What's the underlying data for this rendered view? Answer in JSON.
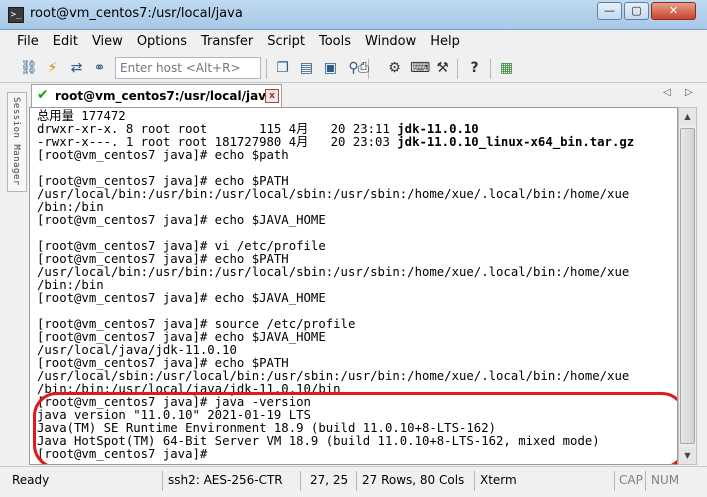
{
  "window": {
    "title": "root@vm_centos7:/usr/local/java",
    "icon_name": "terminal-icon",
    "controls": {
      "minimize": "—",
      "maximize": "▢",
      "close": "✕"
    }
  },
  "menu": [
    "File",
    "Edit",
    "View",
    "Options",
    "Transfer",
    "Script",
    "Tools",
    "Window",
    "Help"
  ],
  "toolbar": {
    "host_placeholder": "Enter host <Alt+R>",
    "icons": [
      "connect-icon",
      "quick-connect-icon",
      "reconnect-icon",
      "disconnect-icon",
      "copy-icon",
      "paste-icon",
      "clipboard-icon",
      "find-icon",
      "print-icon",
      "settings-icon",
      "keyboard-icon",
      "keymap-icon",
      "help-icon",
      "sftp-icon"
    ]
  },
  "tab": {
    "label": "root@vm_centos7:/usr/local/java",
    "status_icon": "✔",
    "close_icon": "x"
  },
  "session_manager_label": "Session Manager",
  "terminal": {
    "lines": [
      {
        "segments": [
          {
            "text": "总用量 177472"
          }
        ]
      },
      {
        "segments": [
          {
            "text": "drwxr-xr-x. 8 root root       115 4月   20 23:11 "
          },
          {
            "text": "jdk-11.0.10",
            "bold": true
          }
        ]
      },
      {
        "segments": [
          {
            "text": "-rwxr-x---. 1 root root 181727980 4月   20 23:03 "
          },
          {
            "text": "jdk-11.0.10_linux-x64_bin.tar.gz",
            "bold": true
          }
        ]
      },
      {
        "segments": [
          {
            "text": "[root@vm_centos7 java]# echo $path"
          }
        ]
      },
      {
        "segments": [
          {
            "text": ""
          }
        ]
      },
      {
        "segments": [
          {
            "text": "[root@vm_centos7 java]# echo $PATH"
          }
        ]
      },
      {
        "segments": [
          {
            "text": "/usr/local/bin:/usr/bin:/usr/local/sbin:/usr/sbin:/home/xue/.local/bin:/home/xue"
          }
        ]
      },
      {
        "segments": [
          {
            "text": "/bin:/bin"
          }
        ]
      },
      {
        "segments": [
          {
            "text": "[root@vm_centos7 java]# echo $JAVA_HOME"
          }
        ]
      },
      {
        "segments": [
          {
            "text": ""
          }
        ]
      },
      {
        "segments": [
          {
            "text": "[root@vm_centos7 java]# vi /etc/profile"
          }
        ]
      },
      {
        "segments": [
          {
            "text": "[root@vm_centos7 java]# echo $PATH"
          }
        ]
      },
      {
        "segments": [
          {
            "text": "/usr/local/bin:/usr/bin:/usr/local/sbin:/usr/sbin:/home/xue/.local/bin:/home/xue"
          }
        ]
      },
      {
        "segments": [
          {
            "text": "/bin:/bin"
          }
        ]
      },
      {
        "segments": [
          {
            "text": "[root@vm_centos7 java]# echo $JAVA_HOME"
          }
        ]
      },
      {
        "segments": [
          {
            "text": ""
          }
        ]
      },
      {
        "segments": [
          {
            "text": "[root@vm_centos7 java]# source /etc/profile"
          }
        ]
      },
      {
        "segments": [
          {
            "text": "[root@vm_centos7 java]# echo $JAVA_HOME"
          }
        ]
      },
      {
        "segments": [
          {
            "text": "/usr/local/java/jdk-11.0.10"
          }
        ]
      },
      {
        "segments": [
          {
            "text": "[root@vm_centos7 java]# echo $PATH"
          }
        ]
      },
      {
        "segments": [
          {
            "text": "/usr/local/sbin:/usr/local/bin:/usr/sbin:/usr/bin:/home/xue/.local/bin:/home/xue"
          }
        ]
      },
      {
        "segments": [
          {
            "text": "/bin:/bin:/usr/local/java/jdk-11.0.10/bin"
          }
        ]
      },
      {
        "segments": [
          {
            "text": "[root@vm_centos7 java]# java -version"
          }
        ]
      },
      {
        "segments": [
          {
            "text": "java version \"11.0.10\" 2021-01-19 LTS"
          }
        ]
      },
      {
        "segments": [
          {
            "text": "Java(TM) SE Runtime Environment 18.9 (build 11.0.10+8-LTS-162)"
          }
        ]
      },
      {
        "segments": [
          {
            "text": "Java HotSpot(TM) 64-Bit Server VM 18.9 (build 11.0.10+8-LTS-162, mixed mode)"
          }
        ]
      },
      {
        "segments": [
          {
            "text": "[root@vm_centos7 java]# "
          }
        ]
      }
    ],
    "highlight_color": "#e01a1a"
  },
  "status": {
    "ready": "Ready",
    "encryption": "ssh2: AES-256-CTR",
    "cursor": "27, 25",
    "size": "27 Rows, 80 Cols",
    "emulation": "Xterm",
    "caps": "CAP",
    "num": "NUM"
  }
}
